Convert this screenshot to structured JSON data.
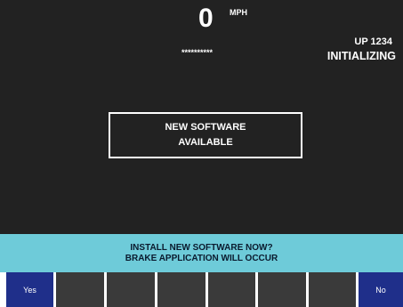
{
  "colors": {
    "screen_bg": "#222222",
    "prompt_bg": "#6ecbd9",
    "prompt_text": "#0a1a2e",
    "softkey_active": "#1f2f8a",
    "softkey_blank": "#3a3a3a"
  },
  "header": {
    "speed_value": "0",
    "speed_unit": "MPH",
    "masked_field": "**********",
    "train_id": "UP 1234",
    "status": "INITIALIZING"
  },
  "message": {
    "line1": "NEW SOFTWARE",
    "line2": "AVAILABLE"
  },
  "prompt": {
    "line1": "INSTALL NEW SOFTWARE NOW?",
    "line2": "BRAKE APPLICATION WILL OCCUR"
  },
  "softkeys": {
    "yes_label": "Yes",
    "no_label": "No"
  }
}
